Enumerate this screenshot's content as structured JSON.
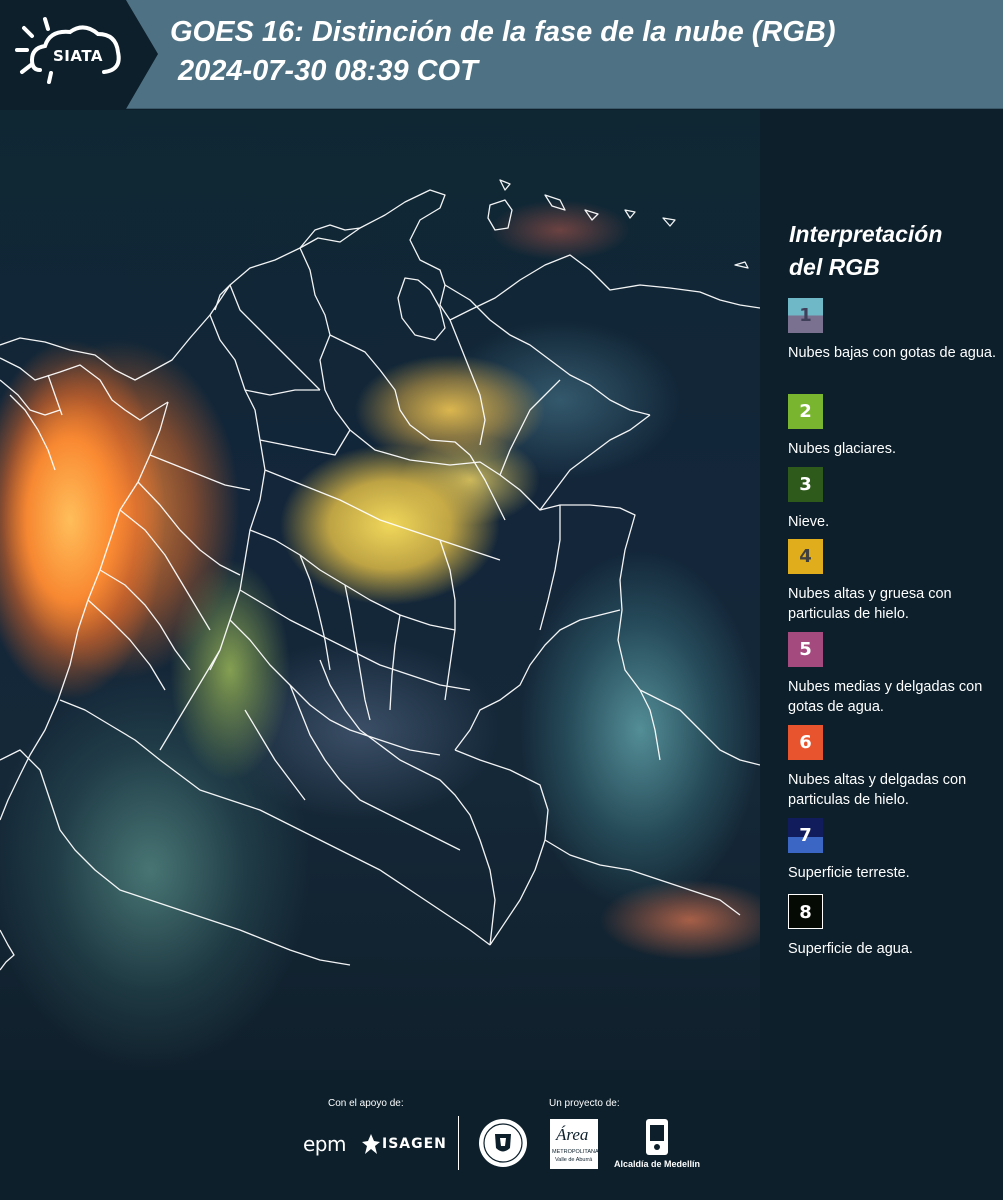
{
  "header": {
    "logo_text": "SIATA",
    "title_line1": "GOES 16: Distinción de la fase de la nube (RGB)",
    "title_line2": "2024-07-30 08:39 COT"
  },
  "legend": {
    "title_line1": "Interpretación",
    "title_line2": "del RGB",
    "items": [
      {
        "number": "1",
        "label": "Nubes bajas con gotas de agua.",
        "color_top": "#6fb8c8",
        "color_bottom": "#7a7090",
        "text_color": "#3f3f5a"
      },
      {
        "number": "2",
        "label": "Nubes glaciares.",
        "color_top": "#79b52e",
        "color_bottom": "#79b52e",
        "text_color": "#ffffff"
      },
      {
        "number": "3",
        "label": "Nieve.",
        "color_top": "#2e5a1c",
        "color_bottom": "#2e5a1c",
        "text_color": "#ffffff"
      },
      {
        "number": "4",
        "label": "Nubes altas y gruesa con particulas de hielo.",
        "color_top": "#e0ae1c",
        "color_bottom": "#e0ae1c",
        "text_color": "#3f3f3f"
      },
      {
        "number": "5",
        "label": "Nubes medias y delgadas con gotas de agua.",
        "color_top": "#a44a7e",
        "color_bottom": "#a44a7e",
        "text_color": "#ffffff"
      },
      {
        "number": "6",
        "label": "Nubes altas y delgadas con particulas de hielo.",
        "color_top": "#e8542e",
        "color_bottom": "#e8542e",
        "text_color": "#ffffff"
      },
      {
        "number": "7",
        "label": "Superficie terreste.",
        "color_top": "#101c5c",
        "color_bottom": "#3b66c4",
        "text_color": "#ffffff"
      },
      {
        "number": "8",
        "label": "Superficie de agua.",
        "color_top": "#050a05",
        "color_bottom": "#050a05",
        "text_color": "#ffffff"
      }
    ]
  },
  "footer": {
    "support_caption": "Con el apoyo de:",
    "project_caption": "Un proyecto de:",
    "epm_logo": "epm",
    "isagen_logo": "ISAGEN",
    "area_logo_main": "Área",
    "area_logo_sub1": "METROPOLITANA",
    "area_logo_sub2": "Valle de Aburrá",
    "medellin_logo": "Alcaldía de Medellín"
  },
  "colors": {
    "header_bg": "#4e7284",
    "page_bg": "#0c1f2b",
    "border_lines": "#ffffff"
  }
}
